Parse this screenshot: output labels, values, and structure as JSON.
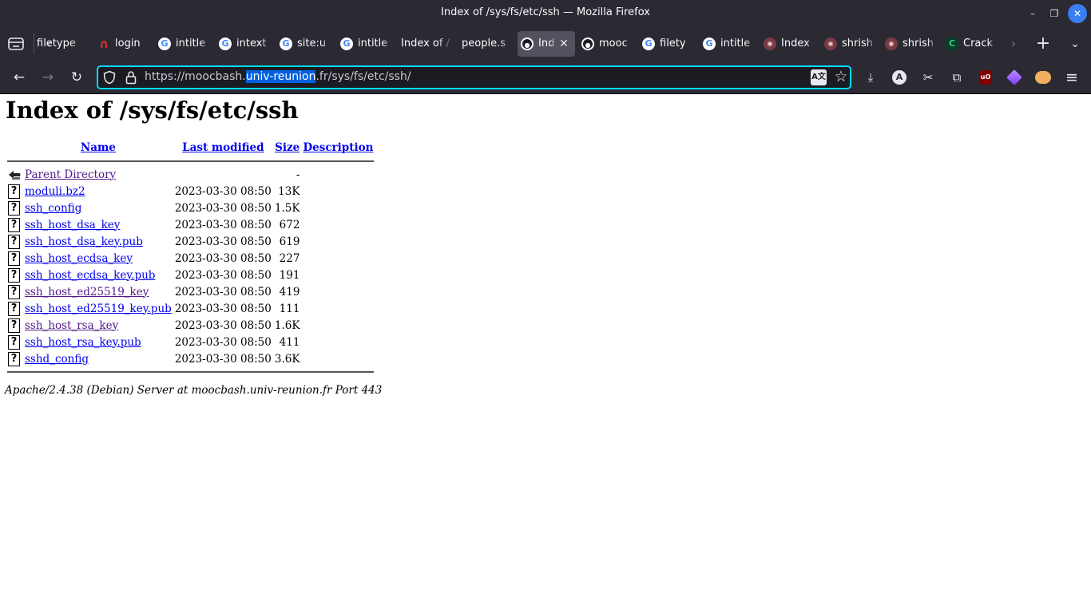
{
  "window": {
    "title": "Index of /sys/fs/etc/ssh — Mozilla Firefox",
    "minimize": "–",
    "maximize": "❐",
    "close": "✕"
  },
  "tabs": [
    {
      "label": "filetype",
      "favicon": "",
      "active": false
    },
    {
      "label": "login",
      "favicon": "login-icon",
      "active": false
    },
    {
      "label": "intitle",
      "favicon": "google-icon",
      "active": false
    },
    {
      "label": "intext",
      "favicon": "google-icon",
      "active": false
    },
    {
      "label": "site:u",
      "favicon": "google-icon",
      "active": false
    },
    {
      "label": "intitle",
      "favicon": "google-icon",
      "active": false
    },
    {
      "label": "Index of /",
      "favicon": "",
      "active": false
    },
    {
      "label": "people.s",
      "favicon": "",
      "active": false
    },
    {
      "label": "Ind",
      "favicon": "penguin-icon",
      "active": true
    },
    {
      "label": "mooc",
      "favicon": "penguin-icon",
      "active": false
    },
    {
      "label": "filety",
      "favicon": "google-icon",
      "active": false
    },
    {
      "label": "intitle",
      "favicon": "google-icon",
      "active": false
    },
    {
      "label": "Index",
      "favicon": "avatar-icon",
      "active": false
    },
    {
      "label": "shrish",
      "favicon": "avatar-icon",
      "active": false
    },
    {
      "label": "shrish",
      "favicon": "avatar-icon",
      "active": false
    },
    {
      "label": "Crack",
      "favicon": "crack-icon",
      "active": false
    }
  ],
  "tab_glyphs": {
    "google": "G",
    "login": "∩",
    "penguin": "●",
    "avatar": "◉",
    "crack": "C",
    "close": "✕"
  },
  "tabstrip": {
    "scroll_left": "‹",
    "scroll_right": "›",
    "new_tab": "+",
    "list_all": "⌄"
  },
  "nav": {
    "back": "←",
    "forward": "→",
    "reload": "↻"
  },
  "url": {
    "prefix": "https://moocbash.",
    "selected": "univ-reunion",
    "suffix": ".fr/sys/fs/etc/ssh/"
  },
  "urlbar_glyphs": {
    "translate": "A文",
    "bookmark": "☆"
  },
  "toolbar_glyphs": {
    "downloads": "⤓",
    "account": "A",
    "screenshot": "✂",
    "extensions": "⧉",
    "ublock": "uO",
    "menu": "≡"
  },
  "page": {
    "heading": "Index of /sys/fs/etc/ssh",
    "columns": {
      "name": "Name",
      "modified": "Last modified",
      "size": "Size",
      "description": "Description"
    },
    "parent": {
      "name": "Parent Directory",
      "size": "-"
    },
    "files": [
      {
        "name": "moduli.bz2",
        "modified": "2023-03-30 08:50",
        "size": "13K",
        "visited": false
      },
      {
        "name": "ssh_config",
        "modified": "2023-03-30 08:50",
        "size": "1.5K",
        "visited": false
      },
      {
        "name": "ssh_host_dsa_key",
        "modified": "2023-03-30 08:50",
        "size": "672",
        "visited": false
      },
      {
        "name": "ssh_host_dsa_key.pub",
        "modified": "2023-03-30 08:50",
        "size": "619",
        "visited": false
      },
      {
        "name": "ssh_host_ecdsa_key",
        "modified": "2023-03-30 08:50",
        "size": "227",
        "visited": false
      },
      {
        "name": "ssh_host_ecdsa_key.pub",
        "modified": "2023-03-30 08:50",
        "size": "191",
        "visited": false
      },
      {
        "name": "ssh_host_ed25519_key",
        "modified": "2023-03-30 08:50",
        "size": "419",
        "visited": true
      },
      {
        "name": "ssh_host_ed25519_key.pub",
        "modified": "2023-03-30 08:50",
        "size": "111",
        "visited": false
      },
      {
        "name": "ssh_host_rsa_key",
        "modified": "2023-03-30 08:50",
        "size": "1.6K",
        "visited": true
      },
      {
        "name": "ssh_host_rsa_key.pub",
        "modified": "2023-03-30 08:50",
        "size": "411",
        "visited": false
      },
      {
        "name": "sshd_config",
        "modified": "2023-03-30 08:50",
        "size": "3.6K",
        "visited": false
      }
    ],
    "file_icon_glyph": "?",
    "server_signature": "Apache/2.4.38 (Debian) Server at moocbash.univ-reunion.fr Port 443"
  },
  "colors": {
    "chrome_bg": "#2b2a33",
    "active_tab": "#52525e",
    "urlbar_focus": "#00ddff",
    "link": "#0000ee",
    "visited_link": "#551a8b",
    "selection": "#0060df"
  }
}
